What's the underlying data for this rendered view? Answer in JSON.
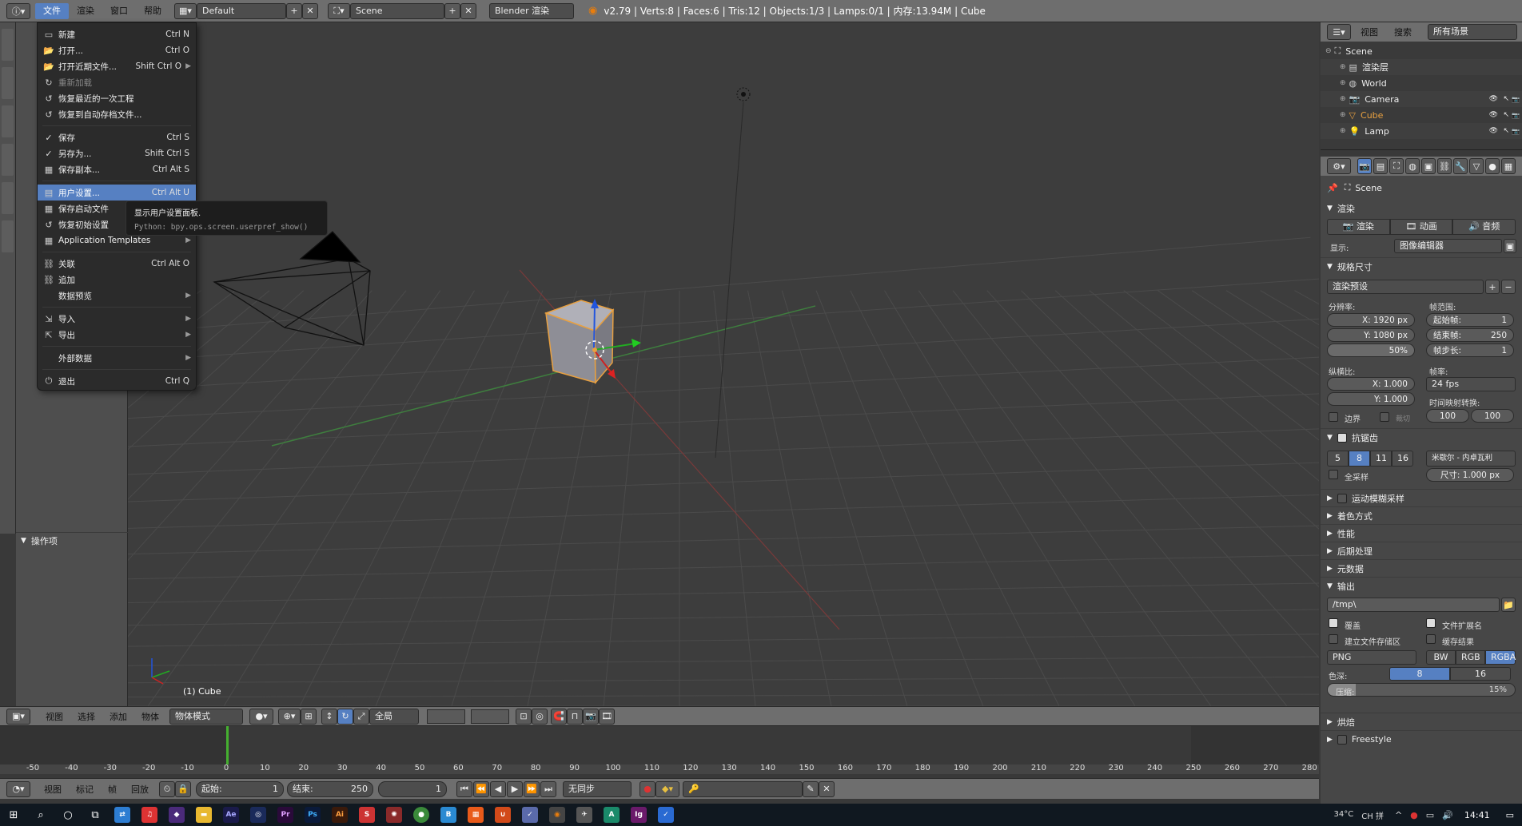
{
  "topbar": {
    "menus": [
      "文件",
      "渲染",
      "窗口",
      "帮助"
    ],
    "layout": "Default",
    "scene": "Scene",
    "engine": "Blender 渲染",
    "stats": "v2.79 | Verts:8 | Faces:6 | Tris:12 | Objects:1/3 | Lamps:0/1 | 内存:13.94M | Cube"
  },
  "file_menu": {
    "items": [
      {
        "label": "新建",
        "shortcut": "Ctrl N",
        "icon": "new-file-icon"
      },
      {
        "label": "打开...",
        "shortcut": "Ctrl O",
        "icon": "open-folder-icon"
      },
      {
        "label": "打开近期文件...",
        "shortcut": "Shift Ctrl O",
        "icon": "open-recent-icon"
      },
      {
        "label": "重新加载",
        "shortcut": "",
        "icon": "reload-icon"
      },
      {
        "label": "恢复最近的一次工程",
        "shortcut": "",
        "icon": "recover-icon"
      },
      {
        "label": "恢复到自动存档文件...",
        "shortcut": "",
        "icon": "recover-auto-icon"
      },
      {
        "label": "保存",
        "shortcut": "Ctrl S",
        "icon": "save-check-icon"
      },
      {
        "label": "另存为...",
        "shortcut": "Shift Ctrl S",
        "icon": "save-as-check-icon"
      },
      {
        "label": "保存副本...",
        "shortcut": "Ctrl Alt S",
        "icon": "save-copy-icon"
      },
      {
        "label": "用户设置...",
        "shortcut": "Ctrl Alt U",
        "icon": "user-prefs-icon"
      },
      {
        "label": "保存启动文件",
        "shortcut": "",
        "icon": "save-startup-icon"
      },
      {
        "label": "恢复初始设置",
        "shortcut": "",
        "icon": "factory-settings-icon"
      },
      {
        "label": "Application Templates",
        "shortcut": "",
        "icon": "templates-icon"
      },
      {
        "label": "关联",
        "shortcut": "Ctrl Alt O",
        "icon": "link-icon"
      },
      {
        "label": "追加",
        "shortcut": "",
        "icon": "append-icon"
      },
      {
        "label": "数据预览",
        "shortcut": "",
        "icon": "data-preview-icon"
      },
      {
        "label": "导入",
        "shortcut": "",
        "icon": "import-icon"
      },
      {
        "label": "导出",
        "shortcut": "",
        "icon": "export-icon"
      },
      {
        "label": "外部数据",
        "shortcut": "",
        "icon": "external-data-icon"
      },
      {
        "label": "退出",
        "shortcut": "Ctrl Q",
        "icon": "quit-icon"
      }
    ]
  },
  "tooltip": {
    "title": "显示用户设置面板.",
    "python": "Python: bpy.ops.screen.userpref_show()"
  },
  "left_panel": {
    "operator_title": "操作项"
  },
  "viewport": {
    "object_label": "(1) Cube"
  },
  "viewport_header": {
    "menus": [
      "视图",
      "选择",
      "添加",
      "物体"
    ],
    "mode": "物体模式",
    "pivot": "全局"
  },
  "timeline": {
    "ticks": [
      "-50",
      "-40",
      "-30",
      "-20",
      "-10",
      "0",
      "10",
      "20",
      "30",
      "40",
      "50",
      "60",
      "70",
      "80",
      "90",
      "100",
      "110",
      "120",
      "130",
      "140",
      "150",
      "160",
      "170",
      "180",
      "190",
      "200",
      "210",
      "220",
      "230",
      "240",
      "250",
      "260",
      "270",
      "280"
    ]
  },
  "timeline_header": {
    "menus": [
      "视图",
      "标记",
      "帧",
      "回放"
    ],
    "start_label": "起始:",
    "start": "1",
    "end_label": "结束:",
    "end": "250",
    "current": "1",
    "sync": "无同步"
  },
  "outliner": {
    "view": "视图",
    "search": "搜索",
    "filter": "所有场景",
    "items": [
      {
        "label": "Scene",
        "indent": 0
      },
      {
        "label": "渲染层",
        "indent": 1
      },
      {
        "label": "World",
        "indent": 1
      },
      {
        "label": "Camera",
        "indent": 1
      },
      {
        "label": "Cube",
        "indent": 1
      },
      {
        "label": "Lamp",
        "indent": 1
      }
    ]
  },
  "properties": {
    "context": "Scene",
    "render_panel": "渲染",
    "render_btn": "渲染",
    "anim_btn": "动画",
    "audio_btn": "音频",
    "display_label": "显示:",
    "display_value": "图像编辑器",
    "dimensions_panel": "规格尺寸",
    "preset": "渲染预设",
    "resolution_label": "分辨率:",
    "res_x": "X: 1920 px",
    "res_y": "Y: 1080 px",
    "res_pct": "50%",
    "frame_range_label": "帧范围:",
    "frame_start": "起始帧:",
    "frame_start_val": "1",
    "frame_end": "结束帧:",
    "frame_end_val": "250",
    "frame_step": "帧步长:",
    "frame_step_val": "1",
    "aspect_label": "纵横比:",
    "aspect_x": "X: 1.000",
    "aspect_y": "Y: 1.000",
    "fps_label": "帧率:",
    "fps": "24 fps",
    "time_remap": "时间映射转换:",
    "remap_old": "100",
    "remap_new": "100",
    "border": "边界",
    "crop": "裁切",
    "aa_panel": "抗锯齿",
    "aa_samples": [
      "5",
      "8",
      "11",
      "16"
    ],
    "aa_filter": "米歇尔 - 内卓瓦利",
    "full_sample": "全采样",
    "filter_size": "尺寸: 1.000 px",
    "motion_blur": "运动模糊采样",
    "shading": "着色方式",
    "performance": "性能",
    "post_processing": "后期处理",
    "metadata": "元数据",
    "output_panel": "输出",
    "output_path": "/tmp\\",
    "overwrite": "覆盖",
    "file_ext": "文件扩展名",
    "placeholders": "建立文件存储区",
    "cache_result": "缓存结果",
    "format": "PNG",
    "color_modes": [
      "BW",
      "RGB",
      "RGBA"
    ],
    "color_depth_label": "色深:",
    "depth_8": "8",
    "depth_16": "16",
    "compression_label": "压缩:",
    "compression": "15%",
    "bake": "烘焙",
    "freestyle": "Freestyle"
  },
  "taskbar": {
    "weather": "34°C",
    "time": "14:41",
    "ime": "CH 拼"
  }
}
